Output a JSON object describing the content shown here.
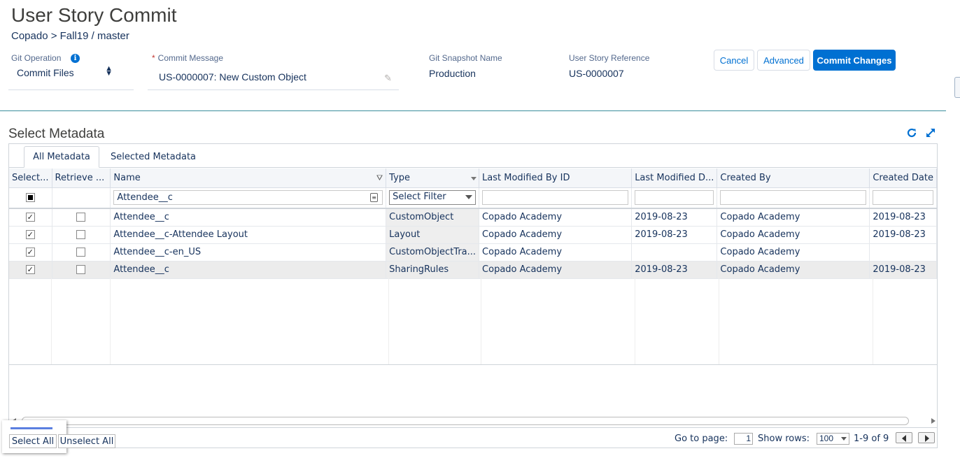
{
  "page": {
    "title": "User Story Commit",
    "breadcrumb": "Copado > Fall19 / master"
  },
  "fields": {
    "git_operation": {
      "label": "Git Operation",
      "value": "Commit Files"
    },
    "commit_message": {
      "label": "Commit Message",
      "value": "US-0000007: New Custom Object"
    },
    "git_snapshot": {
      "label": "Git Snapshot Name",
      "value": "Production"
    },
    "user_story_ref": {
      "label": "User Story Reference",
      "value": "US-0000007"
    }
  },
  "buttons": {
    "cancel": "Cancel",
    "advanced": "Advanced",
    "commit": "Commit Changes"
  },
  "section": {
    "title": "Select Metadata"
  },
  "tabs": [
    "All Metadata",
    "Selected Metadata"
  ],
  "grid": {
    "columns": [
      "Select...",
      "Retrieve ...",
      "Name",
      "Type",
      "Last Modified By ID",
      "Last Modified D...",
      "Created By",
      "Created Date"
    ],
    "filters": {
      "name": "Attendee__c",
      "type": "Select Filter"
    },
    "rows": [
      {
        "selected": "✓",
        "name": "Attendee__c",
        "type": "CustomObject",
        "modified_by": "Copado Academy",
        "modified_date": "2019-08-23",
        "created_by": "Copado Academy",
        "created_date": "2019-08-23"
      },
      {
        "selected": "✓",
        "name": "Attendee__c-Attendee Layout",
        "type": "Layout",
        "modified_by": "Copado Academy",
        "modified_date": "2019-08-23",
        "created_by": "Copado Academy",
        "created_date": "2019-08-23"
      },
      {
        "selected": "✓",
        "name": "Attendee__c-en_US",
        "type": "CustomObjectTra...",
        "modified_by": "Copado Academy",
        "modified_date": "",
        "created_by": "Copado Academy",
        "created_date": ""
      },
      {
        "selected": "✓",
        "name": "Attendee__c",
        "type": "SharingRules",
        "modified_by": "Copado Academy",
        "modified_date": "2019-08-23",
        "created_by": "Copado Academy",
        "created_date": "2019-08-23"
      }
    ]
  },
  "footer": {
    "select_all": "Select All",
    "unselect_all": "Unselect All",
    "go_to_page_label": "Go to page:",
    "page_value": "1",
    "show_rows_label": "Show rows:",
    "rows_value": "100",
    "range": "1-9 of 9"
  },
  "colors": {
    "accent": "#0070d2",
    "divider": "#3a8f9c"
  },
  "icons": [
    "info-icon",
    "sort-arrows-icon",
    "pencil-icon",
    "refresh-icon",
    "expand-icon",
    "filter-icon",
    "clear-icon",
    "checkbox",
    "chevron-left-icon",
    "chevron-right-icon"
  ]
}
